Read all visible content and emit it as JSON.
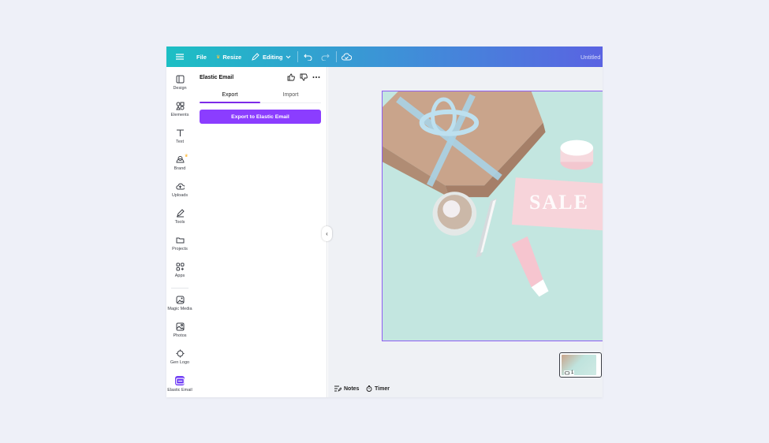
{
  "topbar": {
    "file_label": "File",
    "resize_label": "Resize",
    "editing_label": "Editing",
    "title": "Untitled",
    "gradient_colors": [
      "#1cbfc4",
      "#5a63e2"
    ]
  },
  "rail": {
    "items": [
      {
        "label": "Design",
        "icon": "layout-icon"
      },
      {
        "label": "Elements",
        "icon": "shapes-icon"
      },
      {
        "label": "Text",
        "icon": "text-icon"
      },
      {
        "label": "Brand",
        "icon": "brand-icon"
      },
      {
        "label": "Uploads",
        "icon": "cloud-upload-icon"
      },
      {
        "label": "Tools",
        "icon": "pen-icon"
      },
      {
        "label": "Projects",
        "icon": "folder-icon"
      },
      {
        "label": "Apps",
        "icon": "apps-icon"
      },
      {
        "label": "Magic Media",
        "icon": "magic-media-icon"
      },
      {
        "label": "Photos",
        "icon": "photo-icon"
      },
      {
        "label": "Gen Logo",
        "icon": "gen-logo-icon"
      },
      {
        "label": "Elastic Email",
        "icon": "elastic-email-icon"
      }
    ]
  },
  "panel": {
    "title": "Elastic Email",
    "tabs": [
      {
        "label": "Export",
        "active": true
      },
      {
        "label": "Import",
        "active": false
      }
    ],
    "export_button_label": "Export to Elastic Email",
    "accent_color": "#8b3dff"
  },
  "canvas": {
    "image_text": "SALE",
    "page_number": "1"
  },
  "footer": {
    "notes_label": "Notes",
    "timer_label": "Timer"
  }
}
